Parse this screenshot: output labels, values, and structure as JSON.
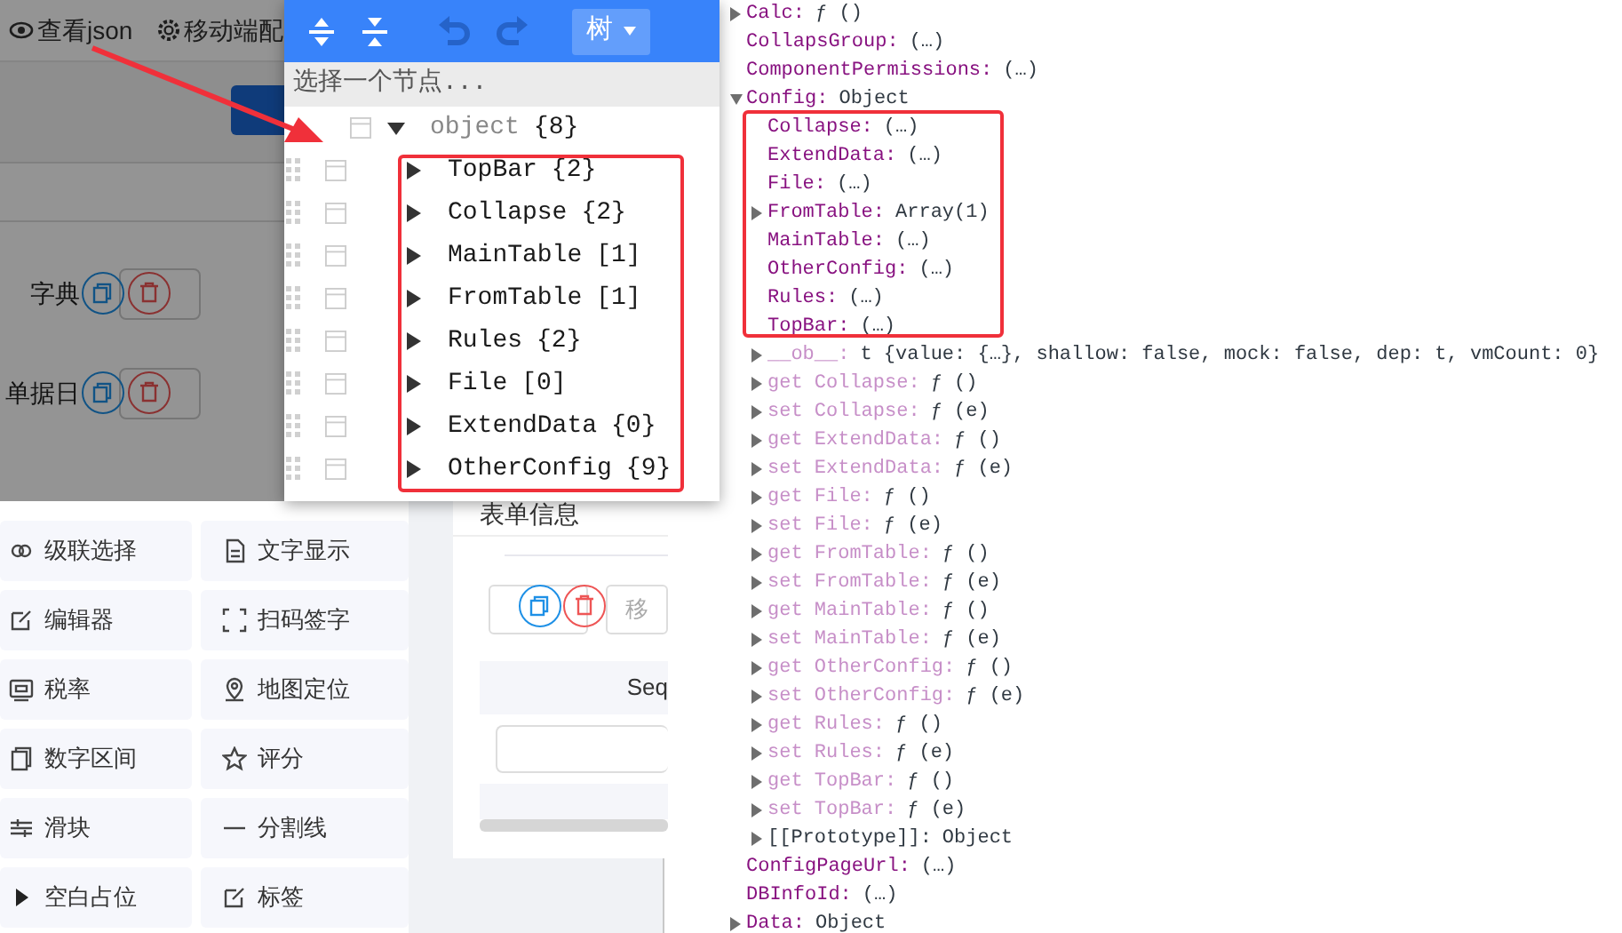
{
  "app_header": {
    "links": [
      {
        "label": "查看json"
      },
      {
        "label": "移动端配"
      }
    ]
  },
  "form_fields": [
    {
      "label": "字典"
    },
    {
      "label": "单据日"
    }
  ],
  "components": [
    {
      "label": "级联选择"
    },
    {
      "label": "文字显示"
    },
    {
      "label": "编辑器"
    },
    {
      "label": "扫码签字"
    },
    {
      "label": "税率"
    },
    {
      "label": "地图定位"
    },
    {
      "label": "数字区间"
    },
    {
      "label": "评分"
    },
    {
      "label": "滑块"
    },
    {
      "label": "分割线"
    },
    {
      "label": "空白占位"
    },
    {
      "label": "标签"
    }
  ],
  "form_panel": {
    "title": "表单信息",
    "move_button": "移",
    "column_1": "Seq"
  },
  "json_editor": {
    "mode": "树",
    "undo_enabled": false,
    "redo_enabled": false,
    "navigation_placeholder": "选择一个节点...",
    "tree": {
      "key": "object",
      "count": "{8}",
      "expanded": true,
      "children": [
        {
          "key": "TopBar",
          "count": "{2}",
          "expanded": false
        },
        {
          "key": "Collapse",
          "count": "{2}",
          "expanded": false
        },
        {
          "key": "MainTable",
          "count": "[1]",
          "expanded": false
        },
        {
          "key": "FromTable",
          "count": "[1]",
          "expanded": false
        },
        {
          "key": "Rules",
          "count": "{2}",
          "expanded": false
        },
        {
          "key": "File",
          "count": "[0]",
          "expanded": false
        },
        {
          "key": "ExtendData",
          "count": "{0}",
          "expanded": false
        },
        {
          "key": "OtherConfig",
          "count": "{9}",
          "expanded": false
        }
      ]
    }
  },
  "console": {
    "lines": [
      {
        "key": "Calc:",
        "value": "ƒ ()",
        "kind": "own",
        "expandable": true,
        "expanded": false
      },
      {
        "key": "CollapsGroup:",
        "value": "(…)",
        "kind": "own",
        "expandable": false
      },
      {
        "key": "ComponentPermissions:",
        "value": "(…)",
        "kind": "own",
        "expandable": false
      },
      {
        "key": "Config:",
        "value": "Object",
        "kind": "own",
        "expandable": true,
        "expanded": true,
        "children": [
          {
            "key": "Collapse:",
            "value": "(…)",
            "kind": "own",
            "expandable": false
          },
          {
            "key": "ExtendData:",
            "value": "(…)",
            "kind": "own",
            "expandable": false
          },
          {
            "key": "File:",
            "value": "(…)",
            "kind": "own",
            "expandable": false
          },
          {
            "key": "FromTable:",
            "value": "Array(1)",
            "kind": "own",
            "expandable": true,
            "expanded": false
          },
          {
            "key": "MainTable:",
            "value": "(…)",
            "kind": "own",
            "expandable": false
          },
          {
            "key": "OtherConfig:",
            "value": "(…)",
            "kind": "own",
            "expandable": false
          },
          {
            "key": "Rules:",
            "value": "(…)",
            "kind": "own",
            "expandable": false
          },
          {
            "key": "TopBar:",
            "value": "(…)",
            "kind": "own",
            "expandable": false
          },
          {
            "key": "__ob__:",
            "value": "t {value: {…}, shallow: false, mock: false, dep: t, vmCount: 0}",
            "kind": "hidden",
            "expandable": true,
            "expanded": false
          },
          {
            "key": "get Collapse:",
            "value": "ƒ ()",
            "kind": "hidden",
            "expandable": true,
            "expanded": false
          },
          {
            "key": "set Collapse:",
            "value": "ƒ (e)",
            "kind": "hidden",
            "expandable": true,
            "expanded": false
          },
          {
            "key": "get ExtendData:",
            "value": "ƒ ()",
            "kind": "hidden",
            "expandable": true,
            "expanded": false
          },
          {
            "key": "set ExtendData:",
            "value": "ƒ (e)",
            "kind": "hidden",
            "expandable": true,
            "expanded": false
          },
          {
            "key": "get File:",
            "value": "ƒ ()",
            "kind": "hidden",
            "expandable": true,
            "expanded": false
          },
          {
            "key": "set File:",
            "value": "ƒ (e)",
            "kind": "hidden",
            "expandable": true,
            "expanded": false
          },
          {
            "key": "get FromTable:",
            "value": "ƒ ()",
            "kind": "hidden",
            "expandable": true,
            "expanded": false
          },
          {
            "key": "set FromTable:",
            "value": "ƒ (e)",
            "kind": "hidden",
            "expandable": true,
            "expanded": false
          },
          {
            "key": "get MainTable:",
            "value": "ƒ ()",
            "kind": "hidden",
            "expandable": true,
            "expanded": false
          },
          {
            "key": "set MainTable:",
            "value": "ƒ (e)",
            "kind": "hidden",
            "expandable": true,
            "expanded": false
          },
          {
            "key": "get OtherConfig:",
            "value": "ƒ ()",
            "kind": "hidden",
            "expandable": true,
            "expanded": false
          },
          {
            "key": "set OtherConfig:",
            "value": "ƒ (e)",
            "kind": "hidden",
            "expandable": true,
            "expanded": false
          },
          {
            "key": "get Rules:",
            "value": "ƒ ()",
            "kind": "hidden",
            "expandable": true,
            "expanded": false
          },
          {
            "key": "set Rules:",
            "value": "ƒ (e)",
            "kind": "hidden",
            "expandable": true,
            "expanded": false
          },
          {
            "key": "get TopBar:",
            "value": "ƒ ()",
            "kind": "hidden",
            "expandable": true,
            "expanded": false
          },
          {
            "key": "set TopBar:",
            "value": "ƒ (e)",
            "kind": "hidden",
            "expandable": true,
            "expanded": false
          },
          {
            "key": "[[Prototype]]:",
            "value": "Object",
            "kind": "internal",
            "expandable": true,
            "expanded": false
          }
        ]
      },
      {
        "key": "ConfigPageUrl:",
        "value": "(…)",
        "kind": "own",
        "expandable": false
      },
      {
        "key": "DBInfoId:",
        "value": "(…)",
        "kind": "own",
        "expandable": false
      },
      {
        "key": "Data:",
        "value": "Object",
        "kind": "own",
        "expandable": true,
        "expanded": false
      }
    ]
  }
}
